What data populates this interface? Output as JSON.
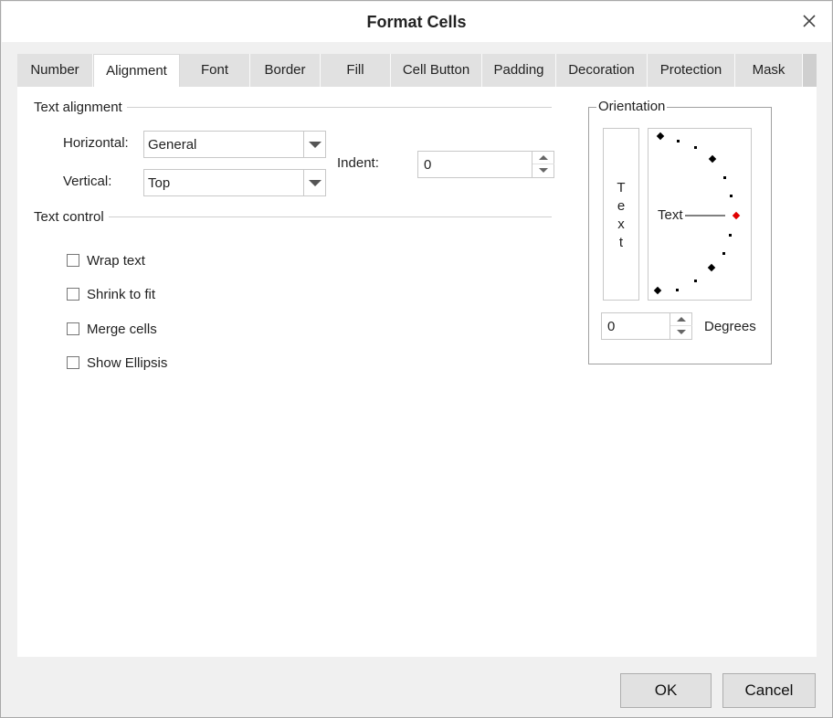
{
  "dialog": {
    "title": "Format Cells"
  },
  "tabs": [
    {
      "label": "Number"
    },
    {
      "label": "Alignment"
    },
    {
      "label": "Font"
    },
    {
      "label": "Border"
    },
    {
      "label": "Fill"
    },
    {
      "label": "Cell Button"
    },
    {
      "label": "Padding"
    },
    {
      "label": "Decoration"
    },
    {
      "label": "Protection"
    },
    {
      "label": "Mask"
    }
  ],
  "active_tab": "Alignment",
  "text_alignment": {
    "title": "Text alignment",
    "horizontal_label": "Horizontal:",
    "horizontal_value": "General",
    "vertical_label": "Vertical:",
    "vertical_value": "Top",
    "indent_label": "Indent:",
    "indent_value": "0"
  },
  "text_control": {
    "title": "Text control",
    "options": [
      {
        "label": "Wrap text",
        "checked": false
      },
      {
        "label": "Shrink to fit",
        "checked": false
      },
      {
        "label": "Merge cells",
        "checked": false
      },
      {
        "label": "Show Ellipsis",
        "checked": false
      }
    ]
  },
  "orientation": {
    "title": "Orientation",
    "vertical_text": [
      "T",
      "e",
      "x",
      "t"
    ],
    "dial_text": "Text",
    "degrees_value": "0",
    "degrees_label": "Degrees",
    "marker_color": "#e00000"
  },
  "footer": {
    "ok_label": "OK",
    "cancel_label": "Cancel"
  }
}
